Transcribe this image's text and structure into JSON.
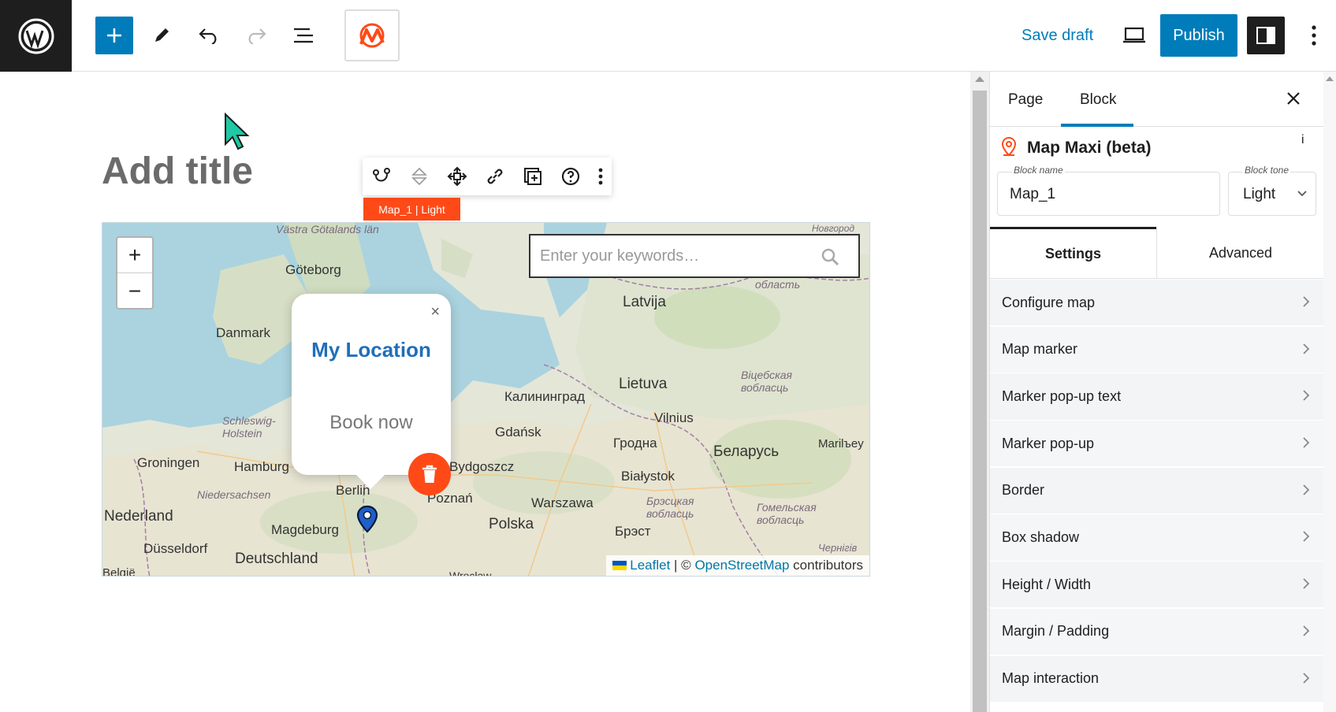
{
  "header": {
    "save_draft": "Save draft",
    "publish": "Publish"
  },
  "editor": {
    "title_placeholder": "Add title",
    "block_label": "Map_1   | Light"
  },
  "map": {
    "search_placeholder": "Enter your keywords…",
    "zoom_in": "+",
    "zoom_out": "−",
    "popup_title": "My Location",
    "popup_body": "Book now",
    "popup_close": "×",
    "attribution": {
      "leaflet": "Leaflet",
      "sep": " | © ",
      "osm": "OpenStreetMap",
      "contributors": " contributors"
    },
    "labels": [
      {
        "text": "Västra Götalands län",
        "cls": "sm"
      },
      {
        "text": "Göteborg",
        "cls": ""
      },
      {
        "text": "Danmark",
        "cls": ""
      },
      {
        "text": "Latvija",
        "cls": ""
      },
      {
        "text": "Lietuva",
        "cls": ""
      },
      {
        "text": "Калининград",
        "cls": ""
      },
      {
        "text": "Vilnius",
        "cls": ""
      },
      {
        "text": "Gdańsk",
        "cls": ""
      },
      {
        "text": "Гродна",
        "cls": ""
      },
      {
        "text": "Беларусь",
        "cls": ""
      },
      {
        "text": "Schleswig-Holstein",
        "cls": "sm"
      },
      {
        "text": "Groningen",
        "cls": ""
      },
      {
        "text": "Hamburg",
        "cls": ""
      },
      {
        "text": "Bydgoszcz",
        "cls": ""
      },
      {
        "text": "Białystok",
        "cls": ""
      },
      {
        "text": "Niedersachsen",
        "cls": "sm"
      },
      {
        "text": "Berlin",
        "cls": ""
      },
      {
        "text": "Poznań",
        "cls": ""
      },
      {
        "text": "Warszawa",
        "cls": ""
      },
      {
        "text": "Nederland",
        "cls": ""
      },
      {
        "text": "Magdeburg",
        "cls": ""
      },
      {
        "text": "Polska",
        "cls": ""
      },
      {
        "text": "Брэст",
        "cls": ""
      },
      {
        "text": "Düsseldorf",
        "cls": ""
      },
      {
        "text": "Deutschland",
        "cls": ""
      },
      {
        "text": "Віцебская вобласць",
        "cls": "sm"
      },
      {
        "text": "Брэсцкая вобласць",
        "cls": "sm"
      },
      {
        "text": "Гомельская вобласць",
        "cls": "sm"
      },
      {
        "text": "Marilъey",
        "cls": ""
      },
      {
        "text": "область",
        "cls": "sm"
      },
      {
        "text": "Новгород",
        "cls": "sm"
      },
      {
        "text": "België",
        "cls": ""
      },
      {
        "text": "Wrocław",
        "cls": ""
      },
      {
        "text": "Чернігів",
        "cls": "sm"
      }
    ]
  },
  "sidebar": {
    "tab_page": "Page",
    "tab_block": "Block",
    "block_title": "Map Maxi (beta)",
    "info": "i",
    "block_name_label": "Block name",
    "block_name_value": "Map_1",
    "block_tone_label": "Block tone",
    "block_tone_value": "Light",
    "subtab_settings": "Settings",
    "subtab_advanced": "Advanced",
    "panels": [
      "Configure map",
      "Map marker",
      "Marker pop-up text",
      "Marker pop-up",
      "Border",
      "Box shadow",
      "Height / Width",
      "Margin / Padding",
      "Map interaction"
    ]
  },
  "colors": {
    "accent": "#007cba",
    "maxi_orange": "#ff4a17",
    "popup_link": "#1f6fba"
  }
}
